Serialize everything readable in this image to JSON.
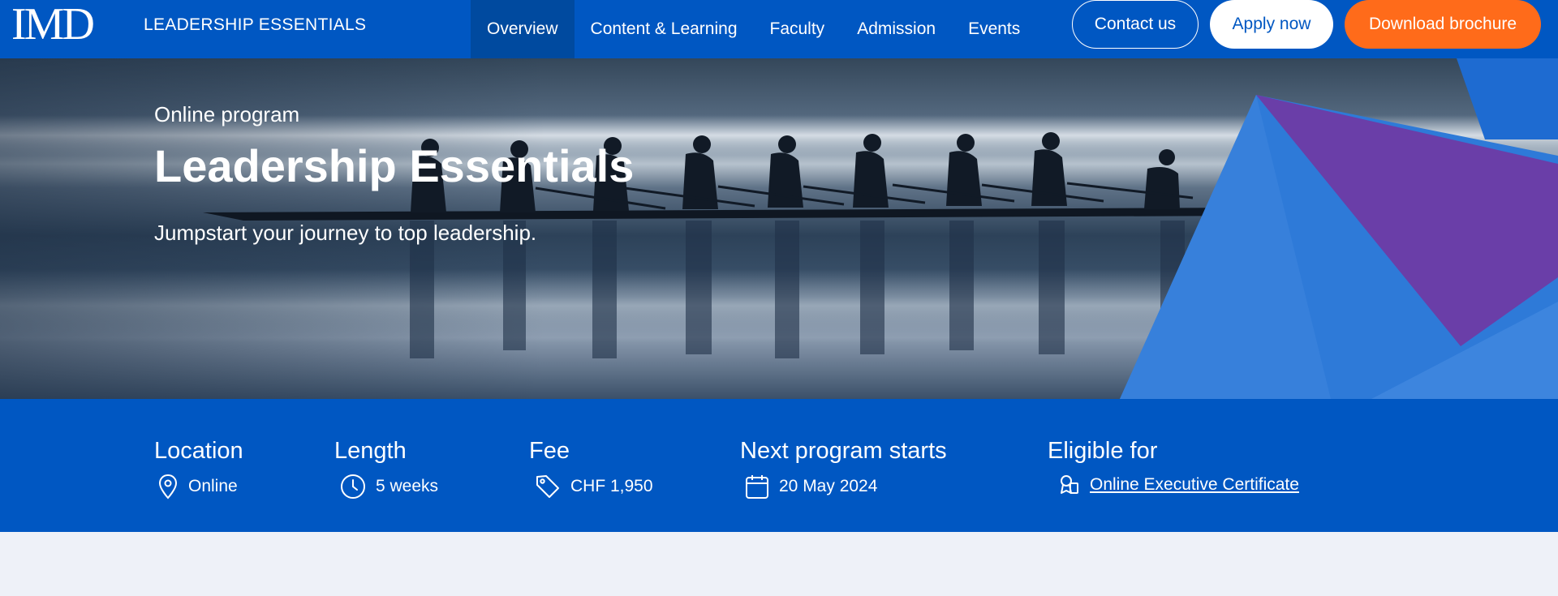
{
  "header": {
    "logo_text": "IMD",
    "brand_title": "LEADERSHIP ESSENTIALS",
    "nav": [
      {
        "label": "Overview",
        "active": true
      },
      {
        "label": "Content & Learning"
      },
      {
        "label": "Faculty"
      },
      {
        "label": "Admission"
      },
      {
        "label": "Events"
      }
    ],
    "buttons": {
      "contact": "Contact us",
      "apply": "Apply now",
      "brochure": "Download brochure"
    }
  },
  "hero": {
    "kicker": "Online program",
    "title": "Leadership Essentials",
    "subtitle": "Jumpstart your journey to top leadership."
  },
  "info": {
    "location": {
      "label": "Location",
      "value": "Online",
      "icon": "map-pin-icon"
    },
    "length": {
      "label": "Length",
      "value": "5 weeks",
      "icon": "clock-icon"
    },
    "fee": {
      "label": "Fee",
      "value": "CHF 1,950",
      "icon": "price-tag-icon"
    },
    "start": {
      "label": "Next program starts",
      "value": "20 May 2024",
      "icon": "calendar-icon"
    },
    "eligible": {
      "label": "Eligible for",
      "value": "Online Executive Certificate",
      "icon": "certificate-icon"
    }
  },
  "colors": {
    "brand_blue": "#0057c2",
    "active_nav": "#004a9f",
    "cta_orange": "#ff6b1a",
    "accent_purple": "#6a3ea8"
  }
}
